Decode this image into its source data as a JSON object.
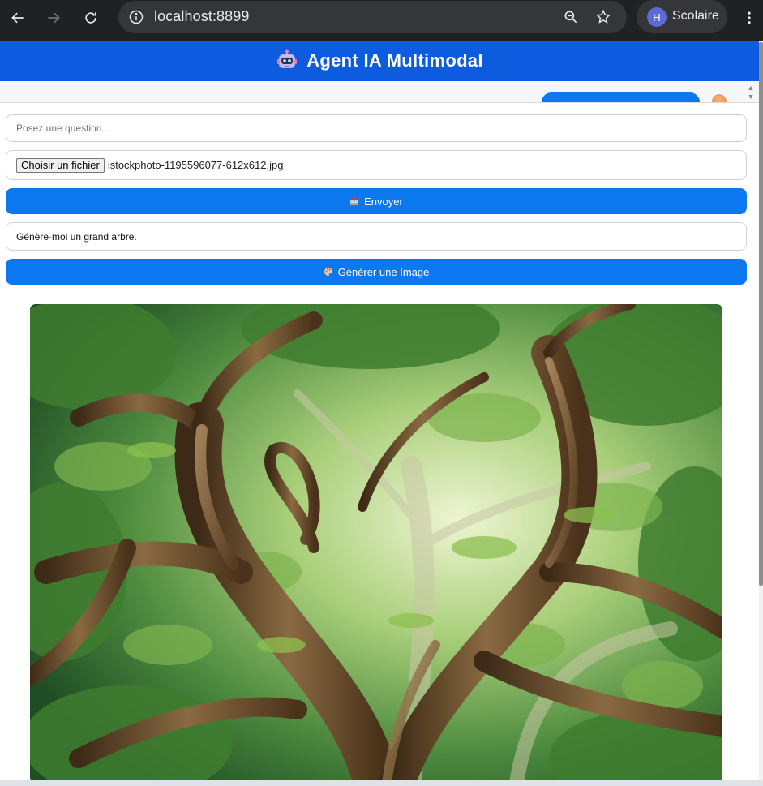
{
  "browser": {
    "url": "localhost:8899",
    "profile_initial": "H",
    "profile_name": "Scolaire",
    "icons": [
      "back-arrow-icon",
      "forward-arrow-icon",
      "reload-icon",
      "info-icon",
      "zoom-icon",
      "star-icon",
      "kebab-menu-icon"
    ]
  },
  "app": {
    "title": "Agent IA Multimodal",
    "header_icon": "robot-icon",
    "accent_color": "#0b78f0",
    "header_color": "#0d5ce0"
  },
  "form": {
    "question_placeholder": "Posez une question...",
    "file_button_label": "Choisir un fichier",
    "file_name": "istockphoto-1195596077-612x612.jpg",
    "send_label": "Envoyer",
    "send_icon": "outbox-icon",
    "image_prompt_value": "Génère-moi un grand arbre.",
    "generate_label": "Générer une Image",
    "generate_icon": "palette-icon"
  },
  "result": {
    "image_subject": "generated-tree-image"
  }
}
